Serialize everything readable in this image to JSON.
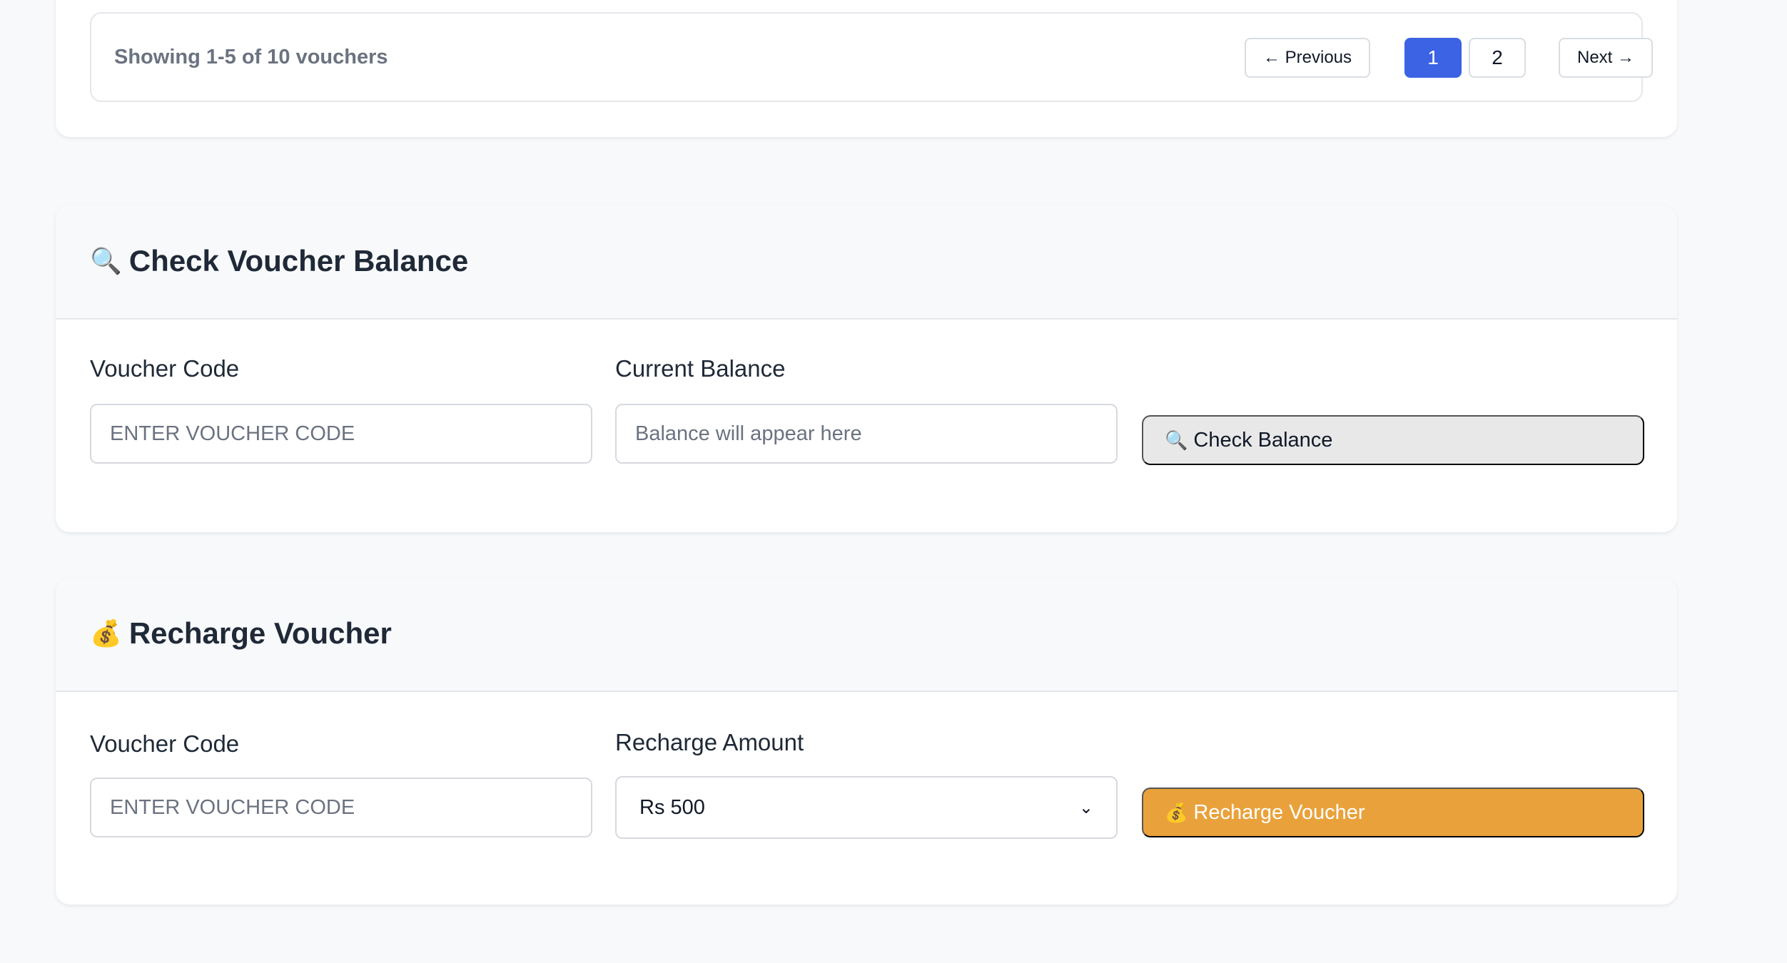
{
  "pagination": {
    "info": "Showing 1-5 of 10 vouchers",
    "prev_label": "← Previous",
    "pages": [
      "1",
      "2"
    ],
    "active_page": "1",
    "next_label": "Next →",
    "active_color": "#3b63e3"
  },
  "check_balance": {
    "title_icon": "🔍",
    "title": "Check Voucher Balance",
    "code_label": "Voucher Code",
    "code_placeholder": "ENTER VOUCHER CODE",
    "balance_label": "Current Balance",
    "balance_placeholder": "Balance will appear here",
    "button_icon": "🔍",
    "button_label": "Check Balance"
  },
  "recharge": {
    "title_icon": "💰",
    "title": "Recharge Voucher",
    "code_label": "Voucher Code",
    "code_placeholder": "ENTER VOUCHER CODE",
    "amount_label": "Recharge Amount",
    "amount_selected": "Rs 500",
    "button_icon": "💰",
    "button_label": "Recharge Voucher",
    "button_color": "#e9a23b"
  }
}
